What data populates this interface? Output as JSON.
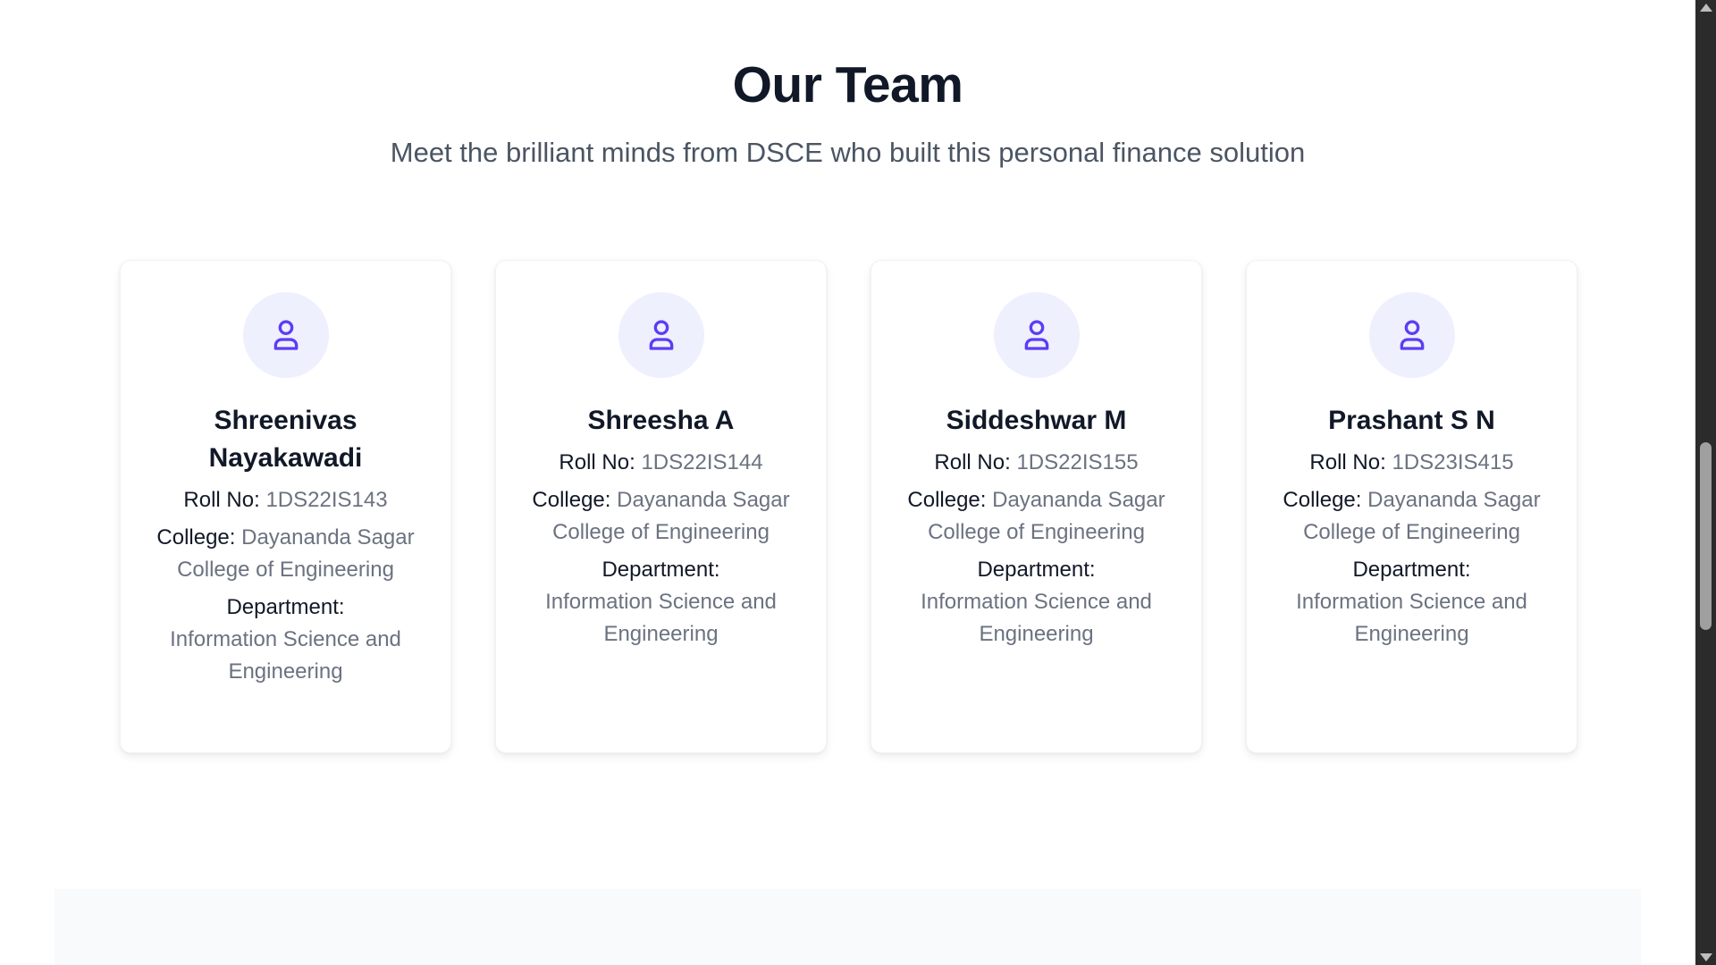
{
  "section": {
    "title": "Our Team",
    "subtitle": "Meet the brilliant minds from DSCE who built this personal finance solution"
  },
  "labels": {
    "roll": "Roll No:",
    "college": "College:",
    "department": "Department:"
  },
  "members": [
    {
      "name": "Shreenivas Nayakawadi",
      "roll": "1DS22IS143",
      "college": "Dayananda Sagar College of Engineering",
      "department": "Information Science and Engineering",
      "icon": "user-icon"
    },
    {
      "name": "Shreesha A",
      "roll": "1DS22IS144",
      "college": "Dayananda Sagar College of Engineering",
      "department": "Information Science and Engineering",
      "icon": "user-icon"
    },
    {
      "name": "Siddeshwar M",
      "roll": "1DS22IS155",
      "college": "Dayananda Sagar College of Engineering",
      "department": "Information Science and Engineering",
      "icon": "user-icon"
    },
    {
      "name": "Prashant S N",
      "roll": "1DS23IS415",
      "college": "Dayananda Sagar College of Engineering",
      "department": "Information Science and Engineering",
      "icon": "user-icon"
    }
  ],
  "colors": {
    "accent": "#5b3df5",
    "avatar_bg": "#eef0fe",
    "heading": "#111827",
    "muted": "#6b7280"
  }
}
